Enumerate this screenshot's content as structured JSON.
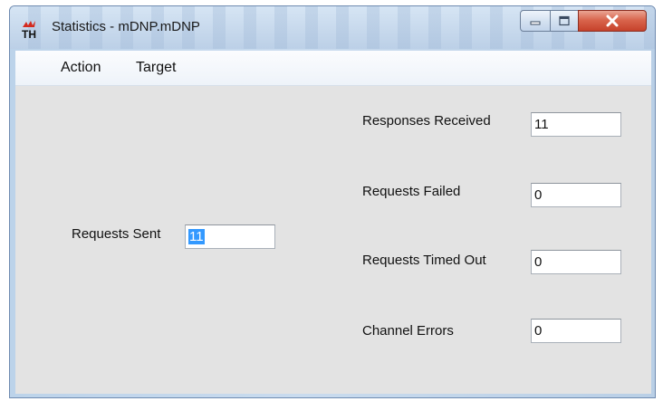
{
  "window": {
    "title": "Statistics - mDNP.mDNP",
    "controls": {
      "minimize": "minimize",
      "maximize": "maximize",
      "close": "close"
    },
    "colors": {
      "client_bg": "#e3e3e3",
      "selection": "#3399ff",
      "close_red": "#c6412a"
    }
  },
  "menu": {
    "items": [
      "Action",
      "Target"
    ]
  },
  "stats": {
    "requests_sent": {
      "label": "Requests Sent",
      "value": "11"
    },
    "responses_received": {
      "label": "Responses Received",
      "value": "11"
    },
    "requests_failed": {
      "label": "Requests Failed",
      "value": "0"
    },
    "requests_timed_out": {
      "label": "Requests Timed Out",
      "value": "0"
    },
    "channel_errors": {
      "label": "Channel Errors",
      "value": "0"
    }
  }
}
